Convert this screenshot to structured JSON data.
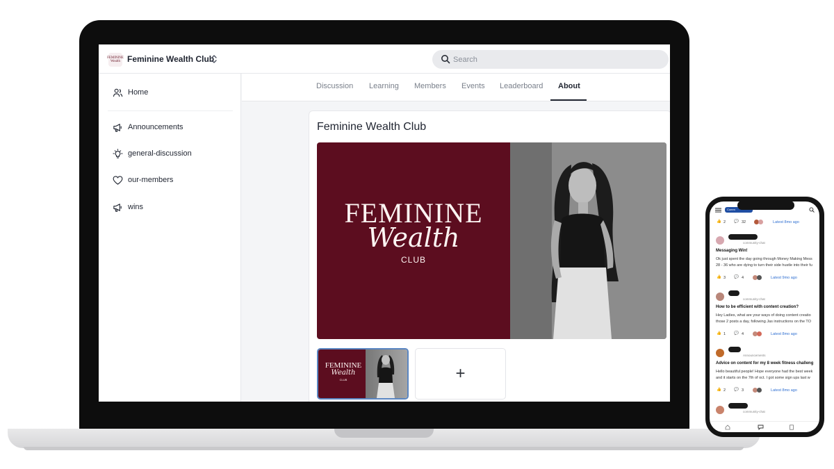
{
  "club": {
    "name": "Feminine Wealth Club",
    "logo_text": "FEMININE Wealth"
  },
  "search": {
    "placeholder": "Search"
  },
  "sidebar": {
    "home_label": "Home",
    "items": [
      {
        "label": "Announcements",
        "icon": "megaphone-icon"
      },
      {
        "label": "general-discussion",
        "icon": "lightbulb-icon"
      },
      {
        "label": "our-members",
        "icon": "heart-icon"
      },
      {
        "label": "wins",
        "icon": "megaphone-icon"
      }
    ]
  },
  "tabs": [
    {
      "label": "Discussion",
      "active": false
    },
    {
      "label": "Learning",
      "active": false
    },
    {
      "label": "Members",
      "active": false
    },
    {
      "label": "Events",
      "active": false
    },
    {
      "label": "Leaderboard",
      "active": false
    },
    {
      "label": "About",
      "active": true
    }
  ],
  "about": {
    "title": "Feminine Wealth Club",
    "hero_logo": {
      "line1": "FEMININE",
      "line2": "Wealth",
      "line3": "CLUB"
    },
    "thumb_logo": {
      "line1": "FEMININE",
      "line2": "Wealth",
      "line3": "CLUB"
    },
    "add_label": "+"
  },
  "phone": {
    "top_stats": {
      "likes": "2",
      "comments": "32",
      "latest": "Latest 8mo ago"
    },
    "posts": [
      {
        "category": "community-chat",
        "title": "Messaging Win!",
        "body_line1": "Ok just spent the day going through Money Making Mess",
        "body_line2": "28 - 36 who are dying to turn their side hustle into their fu",
        "likes": "3",
        "comments": "4",
        "latest": "Latest 9mo ago"
      },
      {
        "category": "community-chat",
        "title": "How to be efficient with content creation?",
        "body_line1": "Hey Ladies, what are your ways of doing content creatio",
        "body_line2": "those 2 posts a day, following Jas instructions on the TO",
        "likes": "1",
        "comments": "4",
        "latest": "Latest 8mo ago"
      },
      {
        "category": "Announcements",
        "title": "Advice on content for my 8 week fitness challeng",
        "body_line1": "Hello beautiful people! Hope everyone had the best week",
        "body_line2": "and it starts on the 7th of oct. I got some sign ups last w",
        "likes": "2",
        "comments": "3",
        "latest": "Latest 8mo ago"
      },
      {
        "category": "community-chat"
      }
    ],
    "chip_label": "Comm"
  },
  "colors": {
    "brand_burgundy": "#5c0d1f",
    "active_tab": "#1f2430",
    "link_blue": "#2f6fd1",
    "selected_thumb_border": "#5a86c2"
  }
}
